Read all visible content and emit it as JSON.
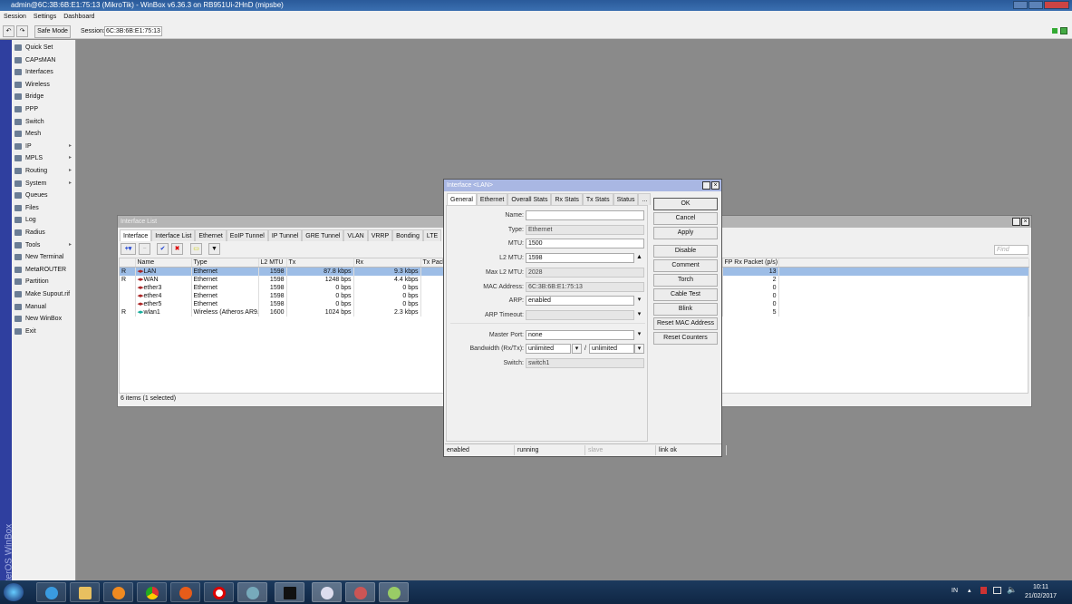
{
  "window": {
    "title": "admin@6C:3B:6B:E1:75:13 (MikroTik) - WinBox v6.36.3 on RB951Ui-2HnD (mipsbe)"
  },
  "menu": [
    "Session",
    "Settings",
    "Dashboard"
  ],
  "toolbar": {
    "safe_mode": "Safe Mode",
    "session_label": "Session:",
    "session_value": "6C:3B:6B:E1:75:13"
  },
  "sidebar": {
    "brand": "RouterOS WinBox",
    "items": [
      {
        "label": "Quick Set"
      },
      {
        "label": "CAPsMAN"
      },
      {
        "label": "Interfaces"
      },
      {
        "label": "Wireless"
      },
      {
        "label": "Bridge"
      },
      {
        "label": "PPP"
      },
      {
        "label": "Switch"
      },
      {
        "label": "Mesh"
      },
      {
        "label": "IP",
        "sub": true
      },
      {
        "label": "MPLS",
        "sub": true
      },
      {
        "label": "Routing",
        "sub": true
      },
      {
        "label": "System",
        "sub": true
      },
      {
        "label": "Queues"
      },
      {
        "label": "Files"
      },
      {
        "label": "Log"
      },
      {
        "label": "Radius"
      },
      {
        "label": "Tools",
        "sub": true
      },
      {
        "label": "New Terminal"
      },
      {
        "label": "MetaROUTER"
      },
      {
        "label": "Partition"
      },
      {
        "label": "Make Supout.rif"
      },
      {
        "label": "Manual"
      },
      {
        "label": "New WinBox"
      },
      {
        "label": "Exit"
      }
    ]
  },
  "interface_list": {
    "title": "Interface List",
    "tabs": [
      "Interface",
      "Interface List",
      "Ethernet",
      "EoIP Tunnel",
      "IP Tunnel",
      "GRE Tunnel",
      "VLAN",
      "VRRP",
      "Bonding",
      "LTE"
    ],
    "find_placeholder": "Find",
    "columns": [
      "",
      "Name",
      "Type",
      "L2 MTU",
      "Tx",
      "Rx",
      "Tx Pack",
      "FP Rx Packet (p/s)",
      ""
    ],
    "rows": [
      {
        "flag": "R",
        "name": "LAN",
        "type": "Ethernet",
        "l2mtu": "1598",
        "tx": "87.8 kbps",
        "rx": "9.3 kbps",
        "fprx": "13",
        "selected": true
      },
      {
        "flag": "R",
        "name": "WAN",
        "type": "Ethernet",
        "l2mtu": "1598",
        "tx": "1248 bps",
        "rx": "4.4 kbps",
        "fprx": "2"
      },
      {
        "flag": "",
        "name": "ether3",
        "type": "Ethernet",
        "l2mtu": "1598",
        "tx": "0 bps",
        "rx": "0 bps",
        "fprx": "0"
      },
      {
        "flag": "",
        "name": "ether4",
        "type": "Ethernet",
        "l2mtu": "1598",
        "tx": "0 bps",
        "rx": "0 bps",
        "fprx": "0"
      },
      {
        "flag": "",
        "name": "ether5",
        "type": "Ethernet",
        "l2mtu": "1598",
        "tx": "0 bps",
        "rx": "0 bps",
        "fprx": "0"
      },
      {
        "flag": "R",
        "name": "wlan1",
        "type": "Wireless (Atheros AR9...",
        "l2mtu": "1600",
        "tx": "1024 bps",
        "rx": "2.3 kbps",
        "fprx": "5"
      }
    ],
    "footer": "6 items (1 selected)"
  },
  "dialog": {
    "title": "Interface <LAN>",
    "tabs": [
      "General",
      "Ethernet",
      "Overall Stats",
      "Rx Stats",
      "Tx Stats",
      "Status",
      "..."
    ],
    "fields": {
      "name": {
        "label": "Name:",
        "value": "LAN"
      },
      "type": {
        "label": "Type:",
        "value": "Ethernet"
      },
      "mtu": {
        "label": "MTU:",
        "value": "1500"
      },
      "l2mtu": {
        "label": "L2 MTU:",
        "value": "1598"
      },
      "maxl2mtu": {
        "label": "Max L2 MTU:",
        "value": "2028"
      },
      "mac": {
        "label": "MAC Address:",
        "value": "6C:3B:6B:E1:75:13"
      },
      "arp": {
        "label": "ARP:",
        "value": "enabled"
      },
      "arp_timeout": {
        "label": "ARP Timeout:",
        "value": ""
      },
      "master_port": {
        "label": "Master Port:",
        "value": "none"
      },
      "bandwidth": {
        "label": "Bandwidth (Rx/Tx):",
        "rx": "unlimited",
        "sep": "/",
        "tx": "unlimited"
      },
      "switch": {
        "label": "Switch:",
        "value": "switch1"
      }
    },
    "buttons": [
      "OK",
      "Cancel",
      "Apply",
      "Disable",
      "Comment",
      "Torch",
      "Cable Test",
      "Blink",
      "Reset MAC Address",
      "Reset Counters"
    ],
    "status": [
      "enabled",
      "running",
      "slave",
      "link ok"
    ]
  },
  "tray": {
    "lang": "IN",
    "time": "10:11",
    "date": "21/02/2017"
  }
}
